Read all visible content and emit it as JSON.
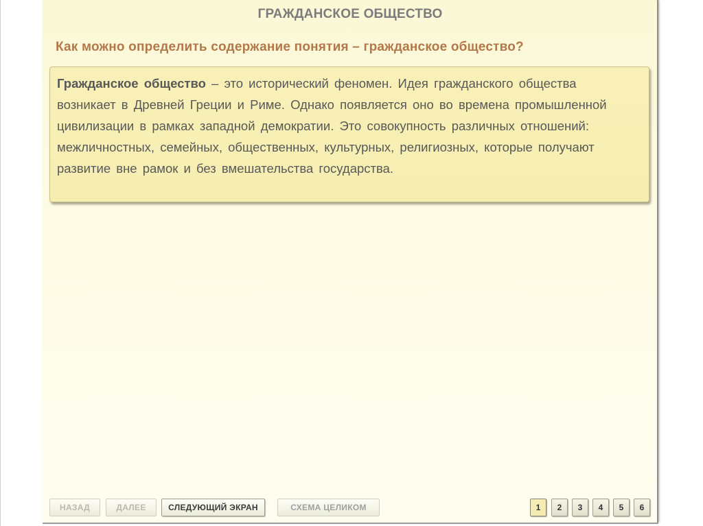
{
  "slide": {
    "title": "ГРАЖДАНСКОЕ ОБЩЕСТВО",
    "question": "Как можно определить содержание понятия – гражданское общество?",
    "definition": {
      "term": "Гражданское общество",
      "text": " – это исторический феномен. Идея гражданского общества возникает в Древней Греции и Риме. Однако появляется оно во времена промышленной цивилизации в рамках западной демократии. Это совокупность различных отношений: межличностных, семейных, общественных, культурных, религиозных, которые получают развитие вне рамок и без вмешательства государства."
    }
  },
  "navigation": {
    "back_label": "НАЗАД",
    "next_label": "ДАЛЕЕ",
    "next_screen_label": "СЛЕДУЮЩИЙ ЭКРАН",
    "schema_label": "СХЕМА ЦЕЛИКОМ",
    "pages": [
      "1",
      "2",
      "3",
      "4",
      "5",
      "6"
    ],
    "current_page": "1"
  },
  "colors": {
    "title": "#7b7b7b",
    "question": "#b3784a",
    "box_background": "#f8f0b8",
    "slide_background": "#fdfbe4"
  }
}
